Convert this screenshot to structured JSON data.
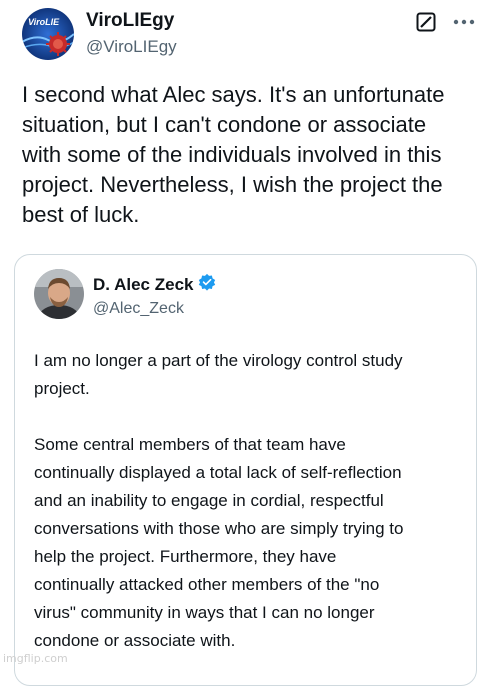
{
  "tweet": {
    "author": {
      "display_name": "ViroLIEgy",
      "handle": "@ViroLIEgy",
      "avatar_icon": "virus-logo-avatar",
      "avatar_logo_text": "ViroLIE"
    },
    "actions": {
      "grok_icon": "grok-icon",
      "more_icon": "more-dots-icon"
    },
    "text_lines": [
      "I second what Alec says. It's an unfortunate",
      "situation, but I can't condone or associate",
      "with some of the individuals involved in this",
      "project. Nevertheless, I wish the project the",
      "best of luck."
    ]
  },
  "quoted": {
    "author": {
      "display_name": "D. Alec Zeck",
      "handle": "@Alec_Zeck",
      "verified_icon": "verified-badge-icon",
      "verified_color": "#1d9bf0"
    },
    "paragraph1_lines": [
      "I am no longer a part of the virology control study",
      "project."
    ],
    "paragraph2_lines": [
      "Some central members of that team have",
      "continually displayed a total lack of self-reflection",
      "and an inability to engage in cordial, respectful",
      "conversations with those who are simply trying to",
      "help the project. Furthermore, they have",
      "continually attacked other members of the \"no",
      "virus\" community in ways that I can no longer",
      "condone or associate with."
    ]
  },
  "watermark": "imgflip.com",
  "colors": {
    "text": "#0f1419",
    "secondary": "#536471",
    "border": "#cfd9de"
  }
}
